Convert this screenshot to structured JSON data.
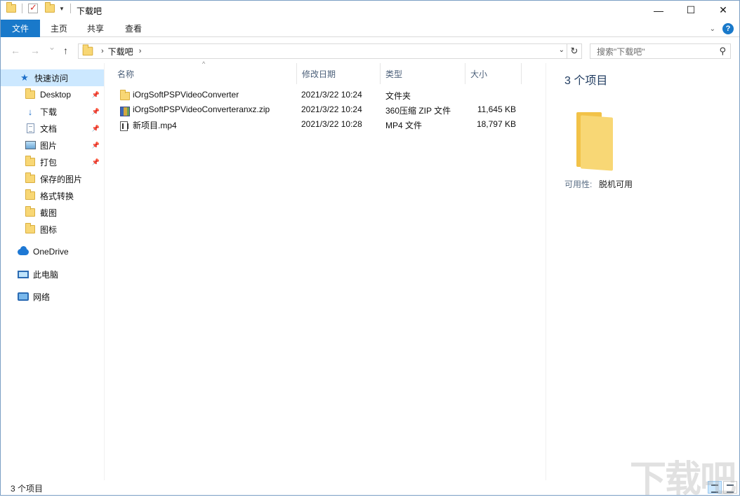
{
  "window": {
    "title": "下载吧",
    "controls": {
      "minimize": "—",
      "maximize": "☐",
      "close": "✕"
    }
  },
  "ribbon": {
    "file_tab": "文件",
    "tabs": [
      "主页",
      "共享",
      "查看"
    ]
  },
  "nav": {
    "back_icon": "←",
    "forward_icon": "→",
    "recent_icon": "⌄",
    "up_icon": "↑",
    "breadcrumb": "下载吧",
    "search_placeholder": "搜索\"下载吧\""
  },
  "sidebar": {
    "items": [
      {
        "label": "快速访问",
        "icon": "star-icon",
        "pinned": false,
        "selected": true
      },
      {
        "label": "Desktop",
        "icon": "folder-icon",
        "pinned": true
      },
      {
        "label": "下载",
        "icon": "download-icon",
        "pinned": true
      },
      {
        "label": "文档",
        "icon": "document-icon",
        "pinned": true
      },
      {
        "label": "图片",
        "icon": "picture-icon",
        "pinned": true
      },
      {
        "label": "打包",
        "icon": "folder-icon",
        "pinned": true
      },
      {
        "label": "保存的图片",
        "icon": "folder-icon",
        "pinned": false
      },
      {
        "label": "格式转换",
        "icon": "folder-icon",
        "pinned": false
      },
      {
        "label": "截图",
        "icon": "folder-icon",
        "pinned": false
      },
      {
        "label": "图标",
        "icon": "folder-icon",
        "pinned": false
      },
      {
        "label": "OneDrive",
        "icon": "cloud-icon",
        "pinned": false
      },
      {
        "label": "此电脑",
        "icon": "computer-icon",
        "pinned": false
      },
      {
        "label": "网络",
        "icon": "network-icon",
        "pinned": false
      }
    ]
  },
  "file_list": {
    "columns": [
      "名称",
      "修改日期",
      "类型",
      "大小"
    ],
    "rows": [
      {
        "name": "iOrgSoftPSPVideoConverter",
        "modified": "2021/3/22 10:24",
        "type": "文件夹",
        "size": "",
        "icon": "folder-icon"
      },
      {
        "name": "iOrgSoftPSPVideoConverteranxz.zip",
        "modified": "2021/3/22 10:24",
        "type": "360压缩 ZIP 文件",
        "size": "11,645 KB",
        "icon": "zip-icon"
      },
      {
        "name": "新项目.mp4",
        "modified": "2021/3/22 10:28",
        "type": "MP4 文件",
        "size": "18,797 KB",
        "icon": "video-file-icon"
      }
    ]
  },
  "details": {
    "title": "3 个项目",
    "availability_label": "可用性:",
    "availability_value": "脱机可用"
  },
  "status": {
    "item_count": "3 个项目"
  },
  "watermark": "下载吧",
  "colors": {
    "accent": "#1979ca",
    "selection": "#cce8ff",
    "folder": "#f8d775"
  }
}
